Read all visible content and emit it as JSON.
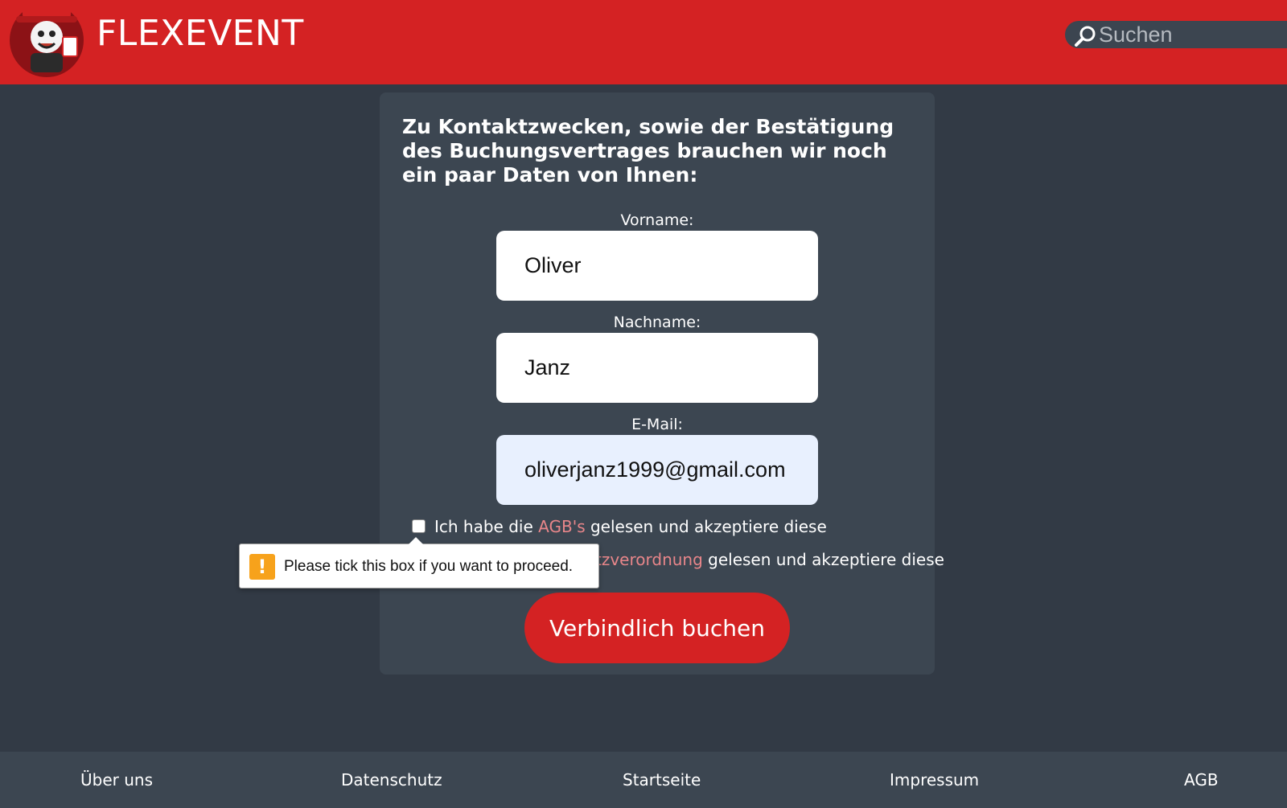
{
  "header": {
    "brand": "FLEXEVENT",
    "logo_icon": "mascot-logo-icon",
    "search_placeholder": "Suchen",
    "colors": {
      "brand_red": "#d42223",
      "background": "#323a45"
    }
  },
  "form": {
    "title": "Zu Kontaktzwecken, sowie der Bestätigung des Buchungsvertrages brauchen wir noch ein paar Daten von Ihnen:",
    "first_name_label": "Vorname:",
    "first_name_value": "Oliver",
    "last_name_label": "Nachname:",
    "last_name_value": "Janz",
    "email_label": "E-Mail:",
    "email_value": "oliverjanz1999@gmail.com",
    "agb_prefix": "Ich habe die ",
    "agb_link": "AGB's",
    "agb_suffix": " gelesen und akzeptiere diese",
    "privacy_link": "tzverordnung",
    "privacy_suffix": " gelesen und akzeptiere diese",
    "submit_label": "Verbindlich buchen"
  },
  "tooltip": {
    "icon": "warning-icon",
    "text": "Please tick this box if you want to proceed."
  },
  "footer": {
    "links": [
      "Über uns",
      "Datenschutz",
      "Startseite",
      "Impressum",
      "AGB"
    ]
  }
}
